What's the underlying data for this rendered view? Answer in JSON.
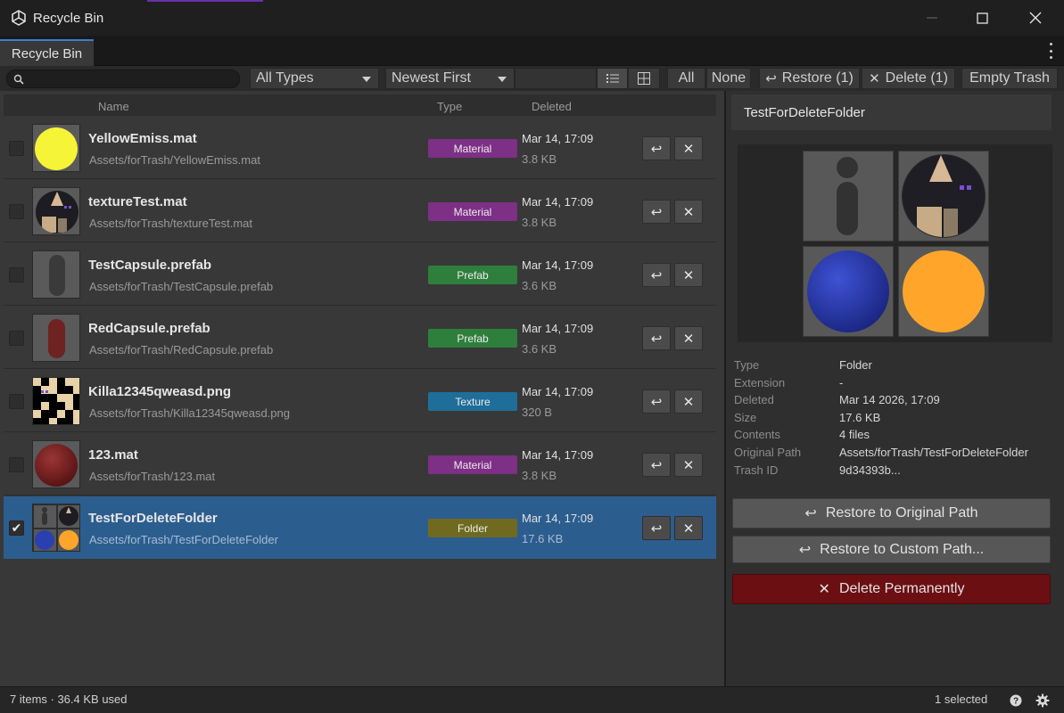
{
  "window": {
    "title": "Recycle Bin",
    "minimize": "—",
    "maximize": "☐",
    "close": "✕"
  },
  "tab": {
    "label": "Recycle Bin"
  },
  "toolbar": {
    "search_value": "",
    "type_filter": "All Types",
    "sort_order": "Newest First",
    "view_mode": "list",
    "select_all": "All",
    "select_none": "None",
    "restore": "Restore (1)",
    "delete": "Delete (1)",
    "empty_trash": "Empty Trash"
  },
  "list": {
    "columns": {
      "name": "Name",
      "type": "Type",
      "deleted": "Deleted"
    },
    "items": [
      {
        "name": "YellowEmiss.mat",
        "path": "Assets/forTrash/YellowEmiss.mat",
        "type": "Material",
        "deleted": "Mar 14, 17:09",
        "size": "3.8 KB",
        "checked": false,
        "thumb": "yellow-sphere"
      },
      {
        "name": "textureTest.mat",
        "path": "Assets/forTrash/textureTest.mat",
        "type": "Material",
        "deleted": "Mar 14, 17:09",
        "size": "3.8 KB",
        "checked": false,
        "thumb": "textured-sphere"
      },
      {
        "name": "TestCapsule.prefab",
        "path": "Assets/forTrash/TestCapsule.prefab",
        "type": "Prefab",
        "deleted": "Mar 14, 17:09",
        "size": "3.6 KB",
        "checked": false,
        "thumb": "grey-capsule"
      },
      {
        "name": "RedCapsule.prefab",
        "path": "Assets/forTrash/RedCapsule.prefab",
        "type": "Prefab",
        "deleted": "Mar 14, 17:09",
        "size": "3.6 KB",
        "checked": false,
        "thumb": "red-capsule"
      },
      {
        "name": "Killa12345qweasd.png",
        "path": "Assets/forTrash/Killa12345qweasd.png",
        "type": "Texture",
        "deleted": "Mar 14, 17:09",
        "size": "320 B",
        "checked": false,
        "thumb": "pixel-texture"
      },
      {
        "name": "123.mat",
        "path": "Assets/forTrash/123.mat",
        "type": "Material",
        "deleted": "Mar 14, 17:09",
        "size": "3.8 KB",
        "checked": false,
        "thumb": "red-sphere"
      },
      {
        "name": "TestForDeleteFolder",
        "path": "Assets/forTrash/TestForDeleteFolder",
        "type": "Folder",
        "deleted": "Mar 14, 17:09",
        "size": "17.6 KB",
        "checked": true,
        "thumb": "folder-grid"
      }
    ]
  },
  "colors": {
    "Material": "#7e2f86",
    "Prefab": "#2f7f3c",
    "Texture": "#1f6e9a",
    "Folder": "#6f6a1f",
    "selection": "#2c5d8f",
    "danger": "#6b0f12"
  },
  "detail": {
    "title": "TestForDeleteFolder",
    "properties": [
      {
        "key": "Type",
        "value": "Folder"
      },
      {
        "key": "Extension",
        "value": "-"
      },
      {
        "key": "Deleted",
        "value": "Mar 14 2026, 17:09"
      },
      {
        "key": "Size",
        "value": "17.6 KB"
      },
      {
        "key": "Contents",
        "value": "4 files"
      },
      {
        "key": "Original Path",
        "value": "Assets/forTrash/TestForDeleteFolder"
      },
      {
        "key": "Trash ID",
        "value": "9d34393b..."
      }
    ],
    "restore_original": "Restore to Original Path",
    "restore_custom": "Restore to Custom Path...",
    "delete_permanently": "Delete Permanently"
  },
  "status": {
    "summary": "7 items · 36.4 KB used",
    "selected": "1 selected"
  }
}
